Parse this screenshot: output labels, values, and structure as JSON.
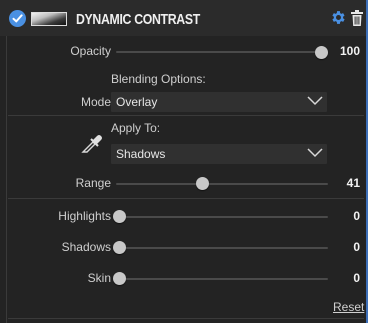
{
  "header": {
    "title": "DYNAMIC CONTRAST",
    "enabled_icon": "check-circle-icon",
    "settings_icon": "gear-icon",
    "delete_icon": "trash-icon",
    "accent_color": "#4a90e2"
  },
  "opacity": {
    "label": "Opacity",
    "value": "100",
    "level": 1.0
  },
  "blending": {
    "section_title": "Blending Options:",
    "mode_label": "Mode",
    "mode_value": "Overlay"
  },
  "apply_to": {
    "section_title": "Apply To:",
    "value": "Shadows",
    "tool_icon": "eyedropper-icon"
  },
  "range": {
    "label": "Range",
    "value": "41",
    "level": 0.41
  },
  "adjustments": [
    {
      "label": "Highlights",
      "value": "0",
      "level": 0
    },
    {
      "label": "Shadows",
      "value": "0",
      "level": 0
    },
    {
      "label": "Skin",
      "value": "0",
      "level": 0
    }
  ],
  "reset_label": "Reset"
}
